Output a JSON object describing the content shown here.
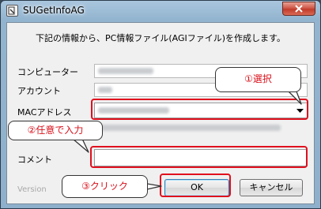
{
  "window": {
    "title": "SUGetInfoAG"
  },
  "intro_text": "下記の情報から、PC情報ファイル(AGIファイル)を作成します。",
  "fields": {
    "computer_label": "コンピューター",
    "account_label": "アカウント",
    "mac_label": "MACアドレス",
    "comment_label": "コメント"
  },
  "version_label": "Version",
  "buttons": {
    "ok": "OK",
    "cancel": "キャンセル"
  },
  "annotations": {
    "select": "①選択",
    "free_input": "②任意で入力",
    "click": "③クリック"
  },
  "colors": {
    "highlight": "#e0101e",
    "annotation_text": "#d8101a"
  }
}
